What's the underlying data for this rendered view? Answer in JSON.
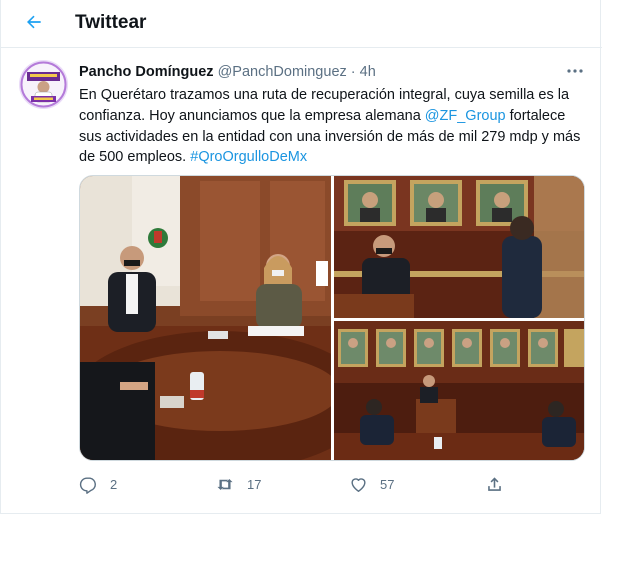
{
  "header": {
    "title": "Twittear"
  },
  "tweet": {
    "author_name": "Pancho Domínguez",
    "handle": "@PanchDominguez",
    "separator": "·",
    "time": "4h",
    "text_part1": "En Querétaro trazamos una ruta de recuperación integral, cuya semilla es la confianza. Hoy anunciamos que la  empresa alemana ",
    "mention": "@ZF_Group",
    "text_part2": " fortalece sus actividades en la entidad con una inversión de más de mil 279 mdp y más de 500 empleos. ",
    "hashtag": "#QroOrgulloDeMx"
  },
  "actions": {
    "replies": "2",
    "retweets": "17",
    "likes": "57"
  },
  "colors": {
    "accent": "#1da1f2",
    "link": "#1b95e0",
    "muted": "#5b7083",
    "border": "#e6ecf0"
  },
  "icons": [
    "back-arrow-icon",
    "more-icon",
    "reply-icon",
    "retweet-icon",
    "like-icon",
    "share-icon"
  ]
}
